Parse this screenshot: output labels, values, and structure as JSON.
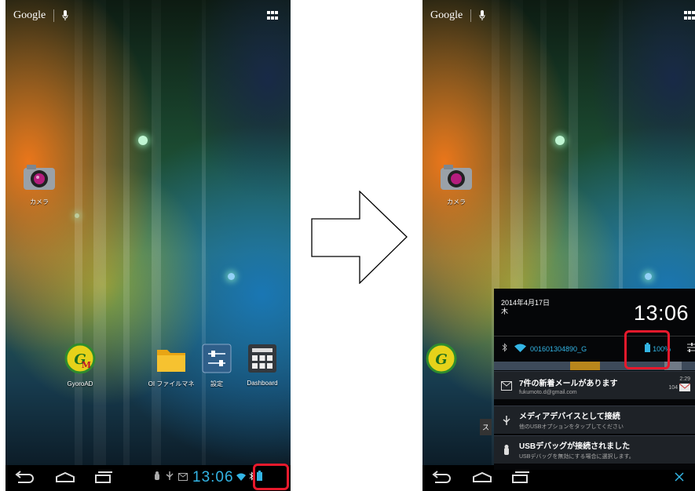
{
  "status_bar": {
    "google_label": "Google"
  },
  "home": {
    "apps": {
      "camera": "カメラ",
      "gyoroad": "GyoroAD",
      "oi_file": "OI ファイルマネ",
      "settings": "設定",
      "dashboard": "Dashboard"
    },
    "gyoroad_letter": "GM"
  },
  "system_bar": {
    "clock": "13:06"
  },
  "notification_shade": {
    "date_line1": "2014年4月17日",
    "date_line2": "木",
    "clock": "13:06",
    "wifi_ssid": "001601304890_G",
    "battery_percent": "100%",
    "notifications": [
      {
        "title": "7件の新着メールがあります",
        "subtitle": "fukumoto.d@gmail.com",
        "time": "2:29",
        "count": "104"
      },
      {
        "title": "メディアデバイスとして接続",
        "subtitle": "他のUSBオプションをタップしてください"
      },
      {
        "title": "USBデバッグが接続されました",
        "subtitle": "USBデバッグを無効にする場合に選択します。"
      }
    ],
    "partial_label": "ス"
  },
  "annotations": {
    "highlight_color": "#e8192c",
    "accent_color": "#33b5e5"
  }
}
